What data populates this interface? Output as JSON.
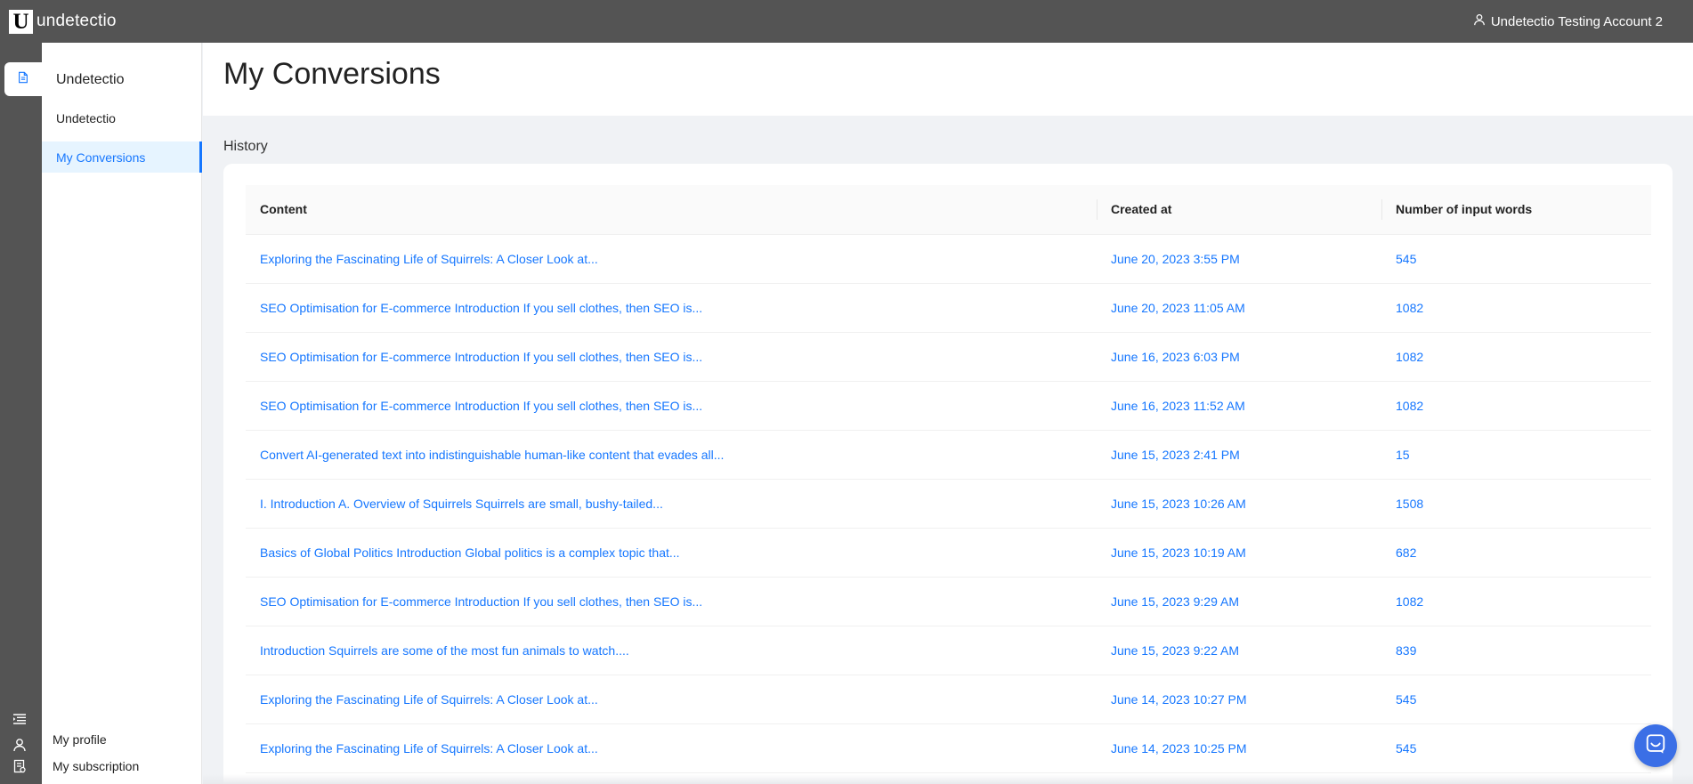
{
  "brand": {
    "logo_letter": "U",
    "name": "undetectio"
  },
  "account": {
    "name": "Undetectio Testing Account 2"
  },
  "sidebar": {
    "title": "Undetectio",
    "items": [
      {
        "label": "Undetectio"
      },
      {
        "label": "My Conversions"
      }
    ],
    "bottom": {
      "profile_label": "My profile",
      "subscription_label": "My subscription"
    }
  },
  "page": {
    "title": "My Conversions",
    "section_label": "History"
  },
  "table": {
    "headers": [
      "Content",
      "Created at",
      "Number of input words"
    ],
    "rows": [
      {
        "content": "Exploring the Fascinating Life of Squirrels: A Closer Look at...",
        "created": "June 20, 2023 3:55 PM",
        "words": "545"
      },
      {
        "content": "SEO Optimisation for E-commerce Introduction If you sell clothes, then SEO is...",
        "created": "June 20, 2023 11:05 AM",
        "words": "1082"
      },
      {
        "content": "SEO Optimisation for E-commerce Introduction If you sell clothes, then SEO is...",
        "created": "June 16, 2023 6:03 PM",
        "words": "1082"
      },
      {
        "content": "SEO Optimisation for E-commerce Introduction If you sell clothes, then SEO is...",
        "created": "June 16, 2023 11:52 AM",
        "words": "1082"
      },
      {
        "content": "Convert AI-generated text into indistinguishable human-like content that evades all...",
        "created": "June 15, 2023 2:41 PM",
        "words": "15"
      },
      {
        "content": "I. Introduction A. Overview of Squirrels Squirrels are small, bushy-tailed...",
        "created": "June 15, 2023 10:26 AM",
        "words": "1508"
      },
      {
        "content": "Basics of Global Politics Introduction Global politics is a complex topic that...",
        "created": "June 15, 2023 10:19 AM",
        "words": "682"
      },
      {
        "content": "SEO Optimisation for E-commerce Introduction If you sell clothes, then SEO is...",
        "created": "June 15, 2023 9:29 AM",
        "words": "1082"
      },
      {
        "content": "Introduction Squirrels are some of the most fun animals to watch....",
        "created": "June 15, 2023 9:22 AM",
        "words": "839"
      },
      {
        "content": "Exploring the Fascinating Life of Squirrels: A Closer Look at...",
        "created": "June 14, 2023 10:27 PM",
        "words": "545"
      },
      {
        "content": "Exploring the Fascinating Life of Squirrels: A Closer Look at...",
        "created": "June 14, 2023 10:25 PM",
        "words": "545"
      }
    ]
  },
  "colors": {
    "accent": "#1677ff",
    "topbar": "#545454",
    "active_bg": "#e6f4ff",
    "chat": "#3b6fe6"
  },
  "icons": {
    "rail_document": "document-icon",
    "rail_menu": "menu-list-icon",
    "rail_profile": "user-icon",
    "rail_subscription": "receipt-icon",
    "account": "user-icon",
    "chat": "chat-icon"
  }
}
